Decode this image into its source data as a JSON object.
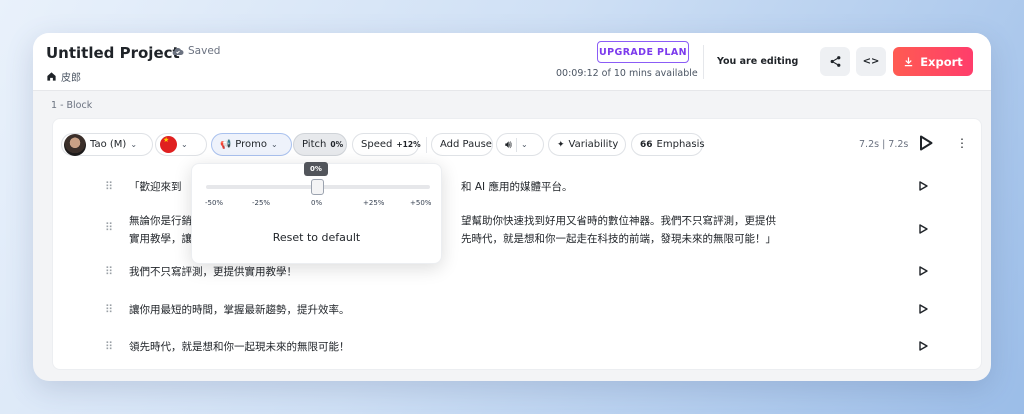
{
  "header": {
    "title": "Untitled Project",
    "saved": "Saved",
    "breadcrumb": "皮郎",
    "upgrade": "UPGRADE PLAN",
    "timer": "00:09:12 of 10 mins available",
    "editing": "You are editing",
    "export": "Export"
  },
  "block": {
    "label": "1 -  Block"
  },
  "toolbar": {
    "voice": "Tao (M)",
    "style": "Promo",
    "pitch_label": "Pitch",
    "pitch_value": "0%",
    "speed_label": "Speed",
    "speed_value": "+12%",
    "add_pause": "Add Pause",
    "variability": "Variability",
    "emphasis": "Emphasis",
    "duration": "7.2s | 7.2s"
  },
  "lines": [
    "「歡迎來到",
    "和 AI 應用的媒體平台。",
    "無論你是行銷",
    "望幫助你快速找到好用又省時的數位神器。我們不只寫評測，更提供",
    "實用教學，讓",
    "先時代，就是想和你一起走在科技的前端，發現未來的無限可能！」",
    "我們不只寫評測，更提供實用教學！",
    "讓你用最短的時間，掌握最新趨勢，提升效率。",
    "領先時代，就是想和你一起現未來的無限可能！"
  ],
  "pitch_popup": {
    "current": "0%",
    "value": 0,
    "ticks": [
      "-50%",
      "-25%",
      "0%",
      "+25%",
      "+50%"
    ],
    "reset": "Reset to default"
  },
  "colors": {
    "accent": "#7c3aed",
    "export": "#ff4d5e"
  }
}
